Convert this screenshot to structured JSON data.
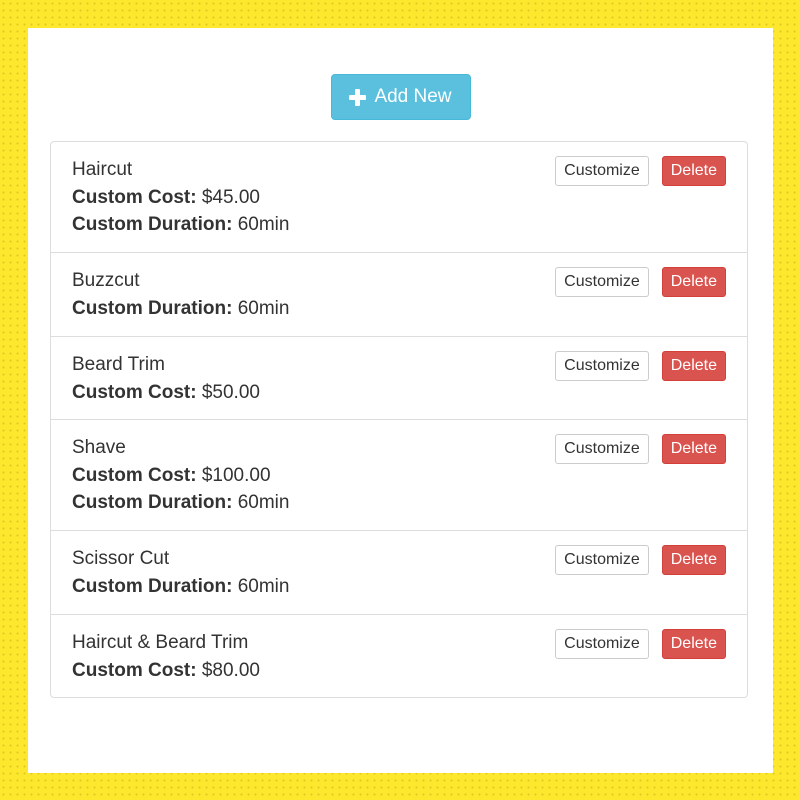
{
  "add_button": {
    "icon": "plus-icon",
    "label": "Add New"
  },
  "services": [
    {
      "name": "Haircut",
      "cost_label": "Custom Cost:",
      "cost": "$45.00",
      "duration_label": "Custom Duration:",
      "duration": "60min",
      "customize_label": "Customize",
      "delete_label": "Delete"
    },
    {
      "name": "Buzzcut",
      "duration_label": "Custom Duration:",
      "duration": "60min",
      "customize_label": "Customize",
      "delete_label": "Delete"
    },
    {
      "name": "Beard Trim",
      "cost_label": "Custom Cost:",
      "cost": "$50.00",
      "customize_label": "Customize",
      "delete_label": "Delete"
    },
    {
      "name": "Shave",
      "cost_label": "Custom Cost:",
      "cost": "$100.00",
      "duration_label": "Custom Duration:",
      "duration": "60min",
      "customize_label": "Customize",
      "delete_label": "Delete"
    },
    {
      "name": "Scissor Cut",
      "duration_label": "Custom Duration:",
      "duration": "60min",
      "customize_label": "Customize",
      "delete_label": "Delete"
    },
    {
      "name": "Haircut & Beard Trim",
      "cost_label": "Custom Cost:",
      "cost": "$80.00",
      "customize_label": "Customize",
      "delete_label": "Delete"
    }
  ],
  "colors": {
    "page_background": "#fde82e",
    "add_button": "#5bc0de",
    "delete_button": "#d9534f",
    "text": "#333333"
  }
}
